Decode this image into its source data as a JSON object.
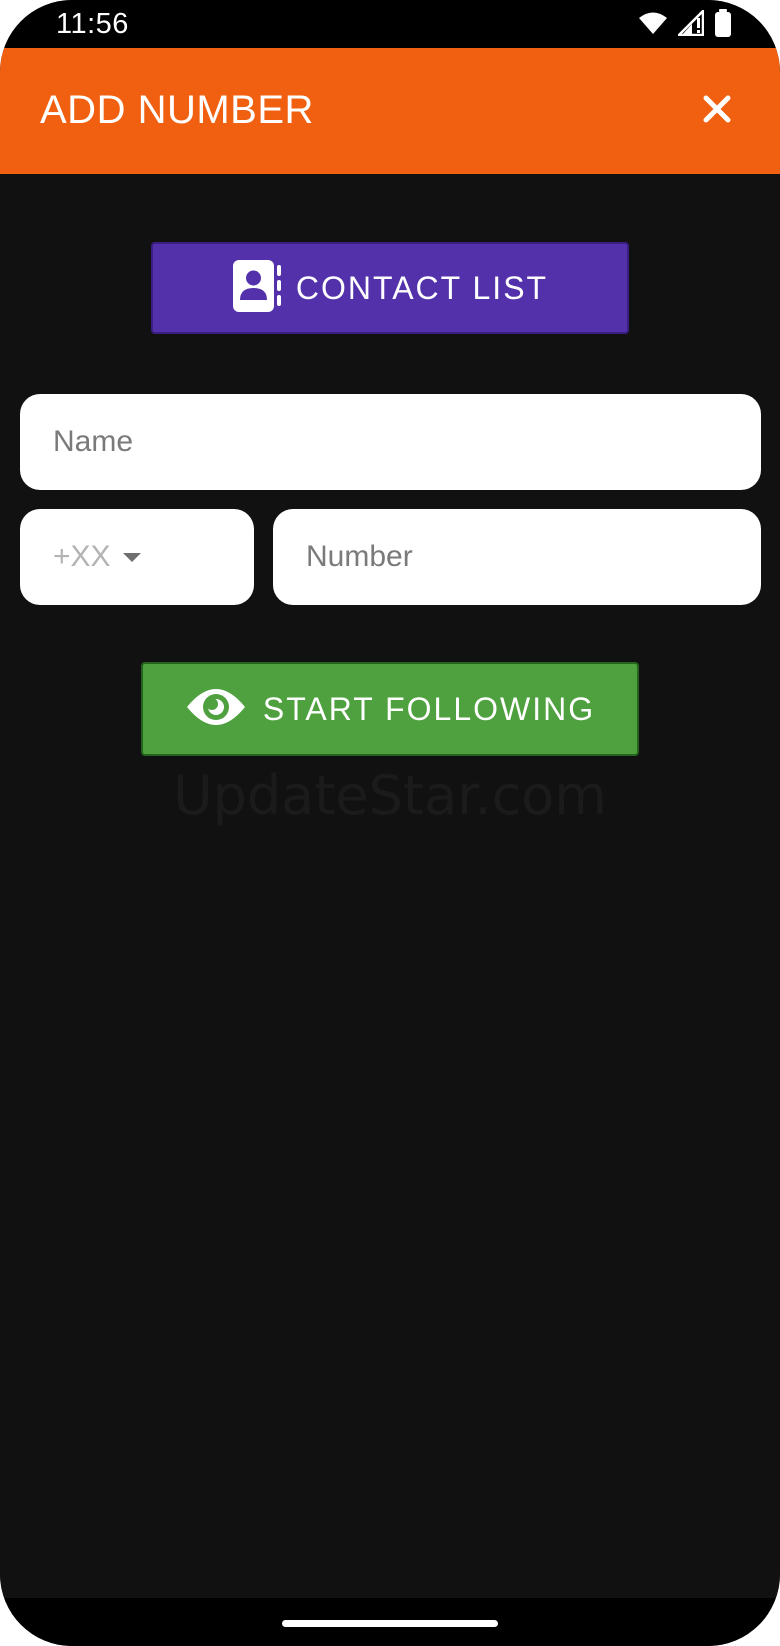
{
  "status_bar": {
    "time": "11:56",
    "icons": [
      "wifi-icon",
      "cellular-signal-icon",
      "battery-icon"
    ]
  },
  "app_bar": {
    "title": "ADD NUMBER",
    "close_icon": "close-icon",
    "background_color": "#f06010"
  },
  "contact_button": {
    "label": "CONTACT LIST",
    "icon": "contact-book-icon",
    "background_color": "#5231ab"
  },
  "form": {
    "name": {
      "placeholder": "Name",
      "value": ""
    },
    "country_code": {
      "value": "+XX"
    },
    "number": {
      "placeholder": "Number",
      "value": ""
    }
  },
  "follow_button": {
    "label": "START FOLLOWING",
    "icon": "eye-icon",
    "background_color": "#4fa13f"
  },
  "watermark": {
    "text": "UpdateStar.com"
  }
}
